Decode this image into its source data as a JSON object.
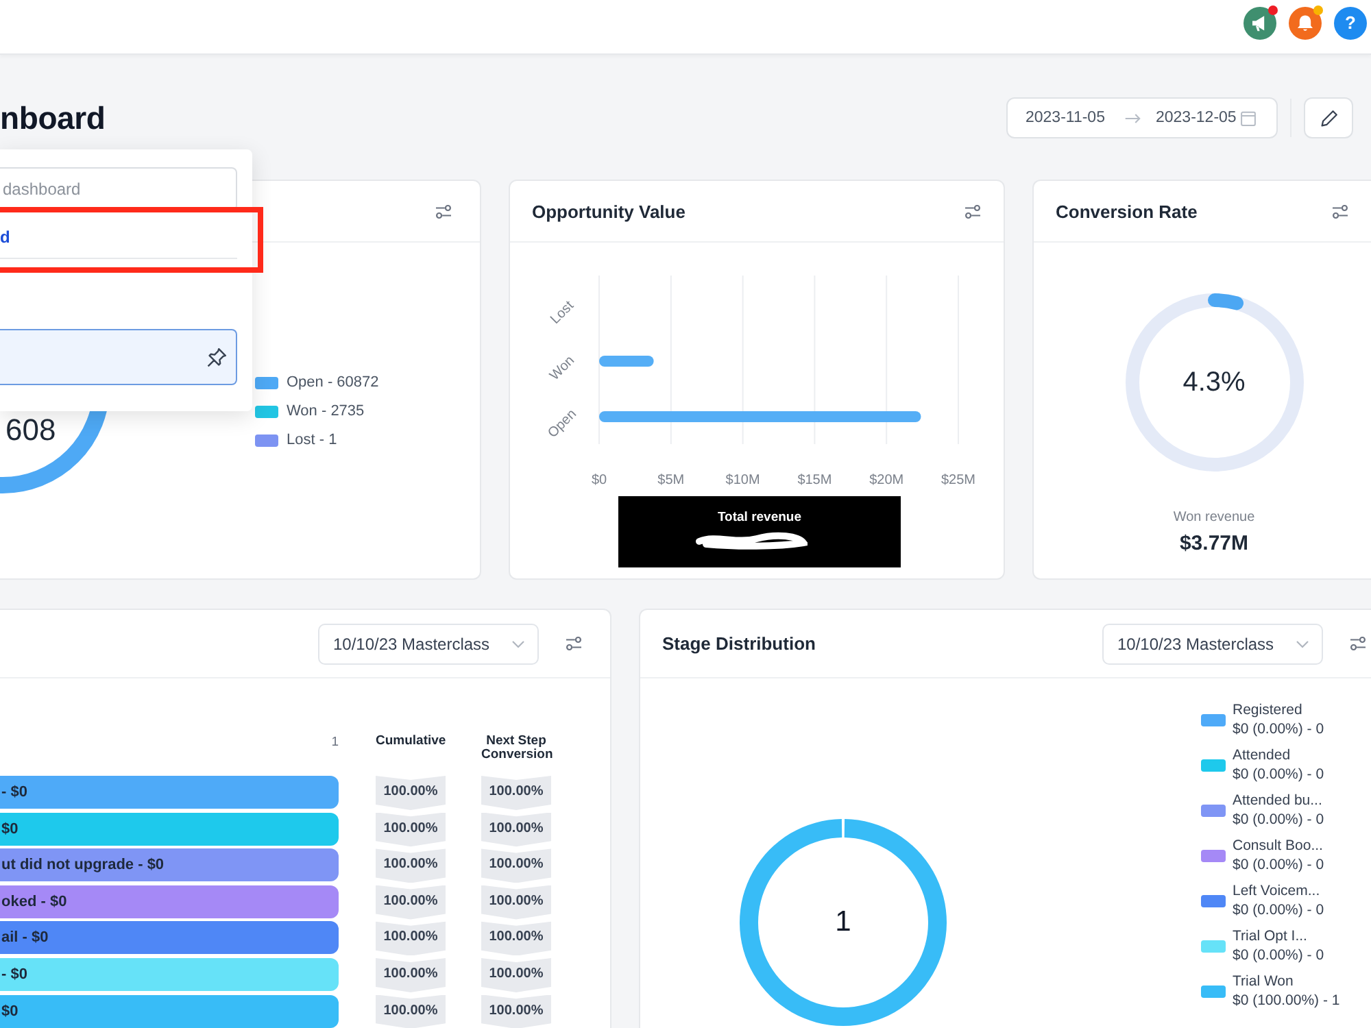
{
  "topbar": {
    "icons": [
      {
        "kind": "megaphone",
        "badge": true,
        "color": "#ee1d25"
      },
      {
        "kind": "bell",
        "badge": true,
        "color": "#f8b400"
      },
      {
        "kind": "help",
        "glyph": "?",
        "badge": false
      }
    ]
  },
  "header": {
    "title": "nboard",
    "date_range": {
      "start": "2023-11-05",
      "end": "2023-12-05"
    }
  },
  "dashboard_menu": {
    "search": {
      "placeholder": "dashboard"
    },
    "items": [
      {
        "label": "d",
        "current": true,
        "selected": false,
        "highlighted": true
      },
      {
        "current": false,
        "selected": true,
        "highlighted": false
      }
    ]
  },
  "status_card": {
    "total": "608",
    "legend": [
      {
        "label": "Open - 60872",
        "color": "#4ea9f5"
      },
      {
        "label": "Won - 2735",
        "color": "#22c5e3"
      },
      {
        "label": "Lost - 1",
        "color": "#7d93f2"
      }
    ]
  },
  "opportunity_card": {
    "title": "Opportunity Value",
    "chart_data": {
      "type": "bar",
      "orientation": "horizontal",
      "grid": true,
      "categories": [
        "Lost",
        "Won",
        "Open"
      ],
      "values": [
        0,
        3800000,
        22400000
      ],
      "xlim": [
        0,
        25000000
      ],
      "xticks": [
        {
          "value": 0,
          "label": "$0"
        },
        {
          "value": 5000000,
          "label": "$5M"
        },
        {
          "value": 10000000,
          "label": "$10M"
        },
        {
          "value": 15000000,
          "label": "$15M"
        },
        {
          "value": 20000000,
          "label": "$20M"
        },
        {
          "value": 25000000,
          "label": "$25M"
        }
      ]
    },
    "overlay_label": "Total revenue"
  },
  "conversion_card": {
    "title": "Conversion Rate",
    "value": "4.3%",
    "level": 0.043,
    "caption": "Won revenue",
    "amount": "$3.77M"
  },
  "funnel_card": {
    "filter": "10/10/23 Masterclass",
    "columns": [
      "1",
      "Cumulative",
      "Next Step Conversion"
    ],
    "rows": [
      {
        "label": "- $0",
        "color": "#4eaaf8",
        "cumulative": "100.00%",
        "next_step": "100.00%"
      },
      {
        "label": "$0",
        "color": "#1ec9ec",
        "cumulative": "100.00%",
        "next_step": "100.00%"
      },
      {
        "label": "ut did not upgrade - $0",
        "color": "#7f95f5",
        "cumulative": "100.00%",
        "next_step": "100.00%"
      },
      {
        "label": "oked - $0",
        "color": "#a589f6",
        "cumulative": "100.00%",
        "next_step": "100.00%"
      },
      {
        "label": "ail - $0",
        "color": "#4f87f6",
        "cumulative": "100.00%",
        "next_step": "100.00%"
      },
      {
        "label": "- $0",
        "color": "#66e2f8",
        "cumulative": "100.00%",
        "next_step": "100.00%"
      },
      {
        "label": "$0",
        "color": "#38bcf7",
        "cumulative": "100.00%",
        "next_step": "100.00%"
      }
    ]
  },
  "stage_card": {
    "title": "Stage Distribution",
    "filter": "10/10/23 Masterclass",
    "center_label": "1",
    "chart_data": {
      "type": "donut",
      "categories": [
        "Registered",
        "Attended",
        "Attended bu...",
        "Consult Boo...",
        "Left Voicem...",
        "Trial Opt I...",
        "Trial Won"
      ],
      "values": [
        0,
        0,
        0,
        0,
        0,
        0,
        1
      ]
    },
    "legend": [
      {
        "detail": "$0 (0.00%) - 0",
        "color": "#4eaaf8"
      },
      {
        "detail": "$0 (0.00%) - 0",
        "color": "#1ec9ec"
      },
      {
        "detail": "$0 (0.00%) - 0",
        "color": "#7f95f5"
      },
      {
        "detail": "$0 (0.00%) - 0",
        "color": "#a589f6"
      },
      {
        "detail": "$0 (0.00%) - 0",
        "color": "#4f87f6"
      },
      {
        "detail": "$0 (0.00%) - 0",
        "color": "#66e2f8"
      },
      {
        "detail": "$0 (100.00%) - 1",
        "color": "#38bcf7"
      }
    ]
  }
}
